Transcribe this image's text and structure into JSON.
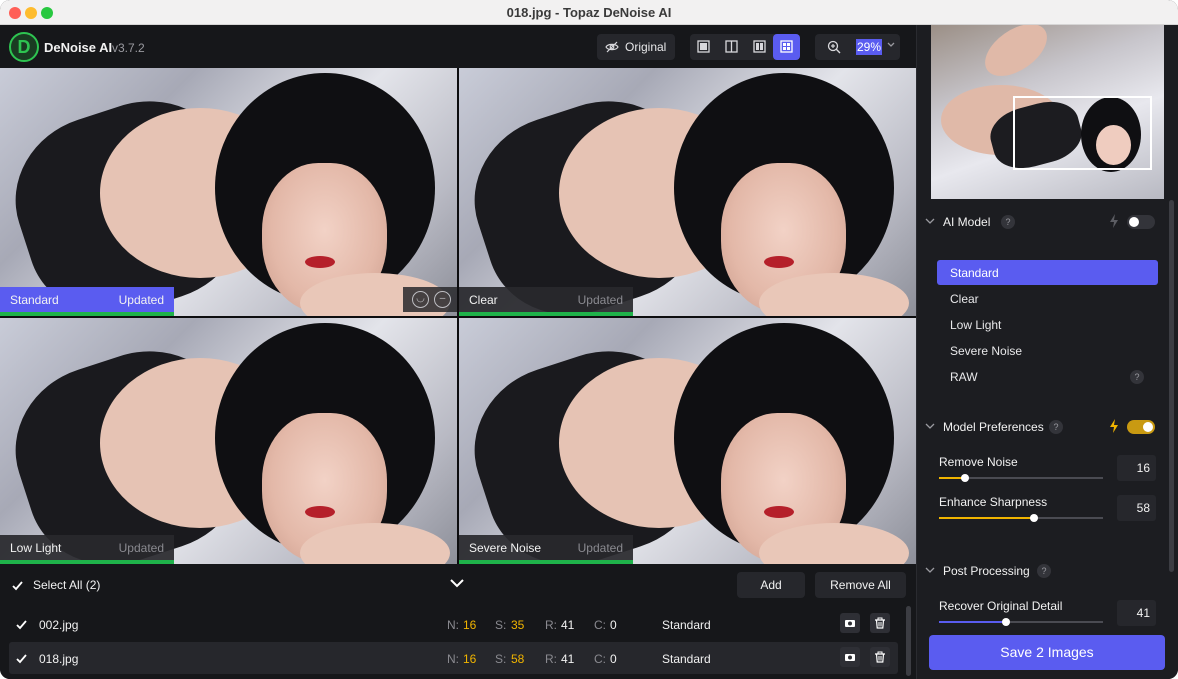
{
  "window": {
    "title": "018.jpg - Topaz DeNoise AI"
  },
  "toolbar": {
    "app_name": "DeNoise AI",
    "app_version": "v3.7.2",
    "logo_letter": "D",
    "original_label": "Original",
    "zoom_value": "29%",
    "view_modes": [
      "single-view-icon",
      "split-view-icon",
      "side-by-side-icon",
      "comparison-grid-icon"
    ],
    "active_view": "comparison-grid-icon"
  },
  "grid": {
    "panes": [
      {
        "name": "Standard",
        "status": "Updated",
        "active": true
      },
      {
        "name": "Clear",
        "status": "Updated",
        "active": false
      },
      {
        "name": "Low Light",
        "status": "Updated",
        "active": false
      },
      {
        "name": "Severe Noise",
        "status": "Updated",
        "active": false
      }
    ],
    "feedback_icons": [
      "smile-icon",
      "neutral-face-icon"
    ]
  },
  "filelist": {
    "select_all_label": "Select All (2)",
    "add_label": "Add",
    "remove_all_label": "Remove All",
    "rows": [
      {
        "file": "002.jpg",
        "n_key": "N:",
        "n": "16",
        "s_key": "S:",
        "s": "35",
        "r_key": "R:",
        "r": "41",
        "c_key": "C:",
        "c": "0",
        "model": "Standard",
        "selected": false
      },
      {
        "file": "018.jpg",
        "n_key": "N:",
        "n": "16",
        "s_key": "S:",
        "s": "58",
        "r_key": "R:",
        "r": "41",
        "c_key": "C:",
        "c": "0",
        "model": "Standard",
        "selected": true
      }
    ]
  },
  "panel": {
    "ai_model": {
      "title": "AI Model",
      "help": "?",
      "auto_enabled": false,
      "models": [
        "Standard",
        "Clear",
        "Low Light",
        "Severe Noise",
        "RAW"
      ],
      "selected": "Standard",
      "raw_help": "?"
    },
    "preferences": {
      "title": "Model Preferences",
      "help": "?",
      "auto_enabled": true,
      "remove_noise": {
        "label": "Remove Noise",
        "value": "16",
        "fraction": 0.16
      },
      "enhance_sharpness": {
        "label": "Enhance Sharpness",
        "value": "58",
        "fraction": 0.58
      }
    },
    "post_processing": {
      "title": "Post Processing",
      "help": "?",
      "recover_detail": {
        "label": "Recover Original Detail",
        "value": "41",
        "fraction": 0.41
      }
    },
    "save_label": "Save 2 Images"
  },
  "colors": {
    "accent": "#5a5cf0",
    "success": "#1fb24a",
    "highlight": "#f0b400",
    "background": "#1c1d21"
  }
}
